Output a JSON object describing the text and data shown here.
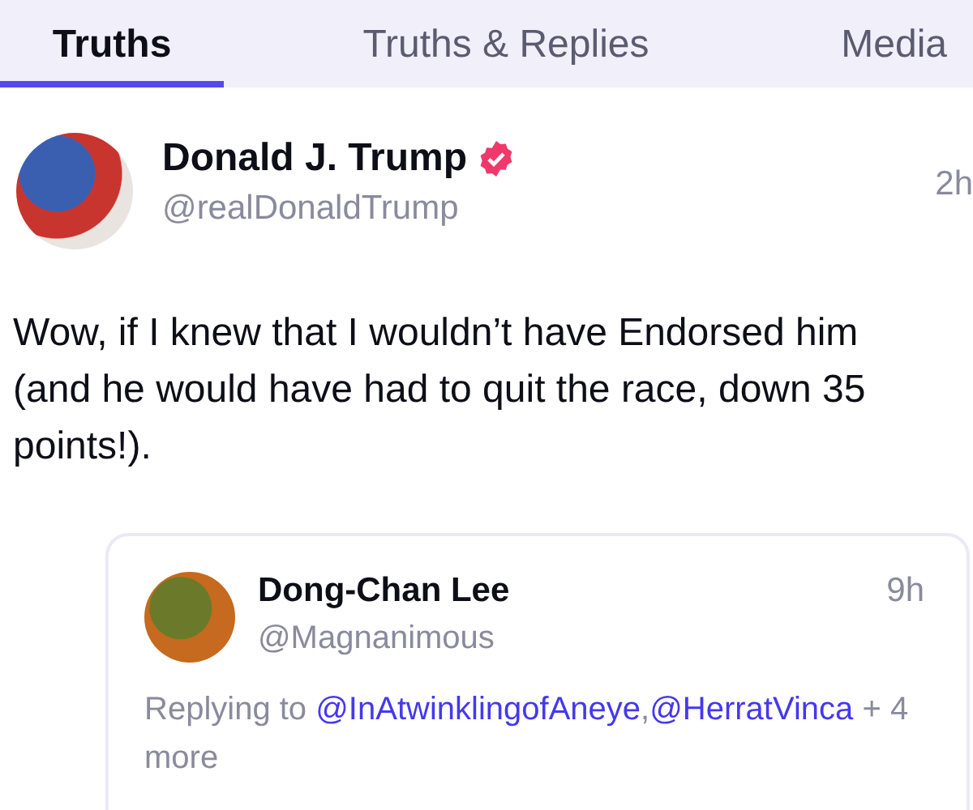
{
  "tabs": [
    {
      "label": "Truths",
      "selected": true
    },
    {
      "label": "Truths & Replies",
      "selected": false
    },
    {
      "label": "Media",
      "selected": false
    }
  ],
  "post": {
    "author": "Donald J. Trump",
    "verified": true,
    "handle": "@realDonaldTrump",
    "time": "2h",
    "text": "Wow, if I knew that I wouldn’t have Endorsed him (and he would have had to quit the race, down 35 points!).",
    "quote": {
      "author": "Dong-Chan Lee",
      "handle": "@Magnanimous",
      "time": "9h",
      "replying_prefix": "Replying to",
      "mentions": [
        "@InAtwinklingofAneye",
        "@HerratVinca"
      ],
      "separator": ",",
      "more": "+ 4 more"
    }
  }
}
